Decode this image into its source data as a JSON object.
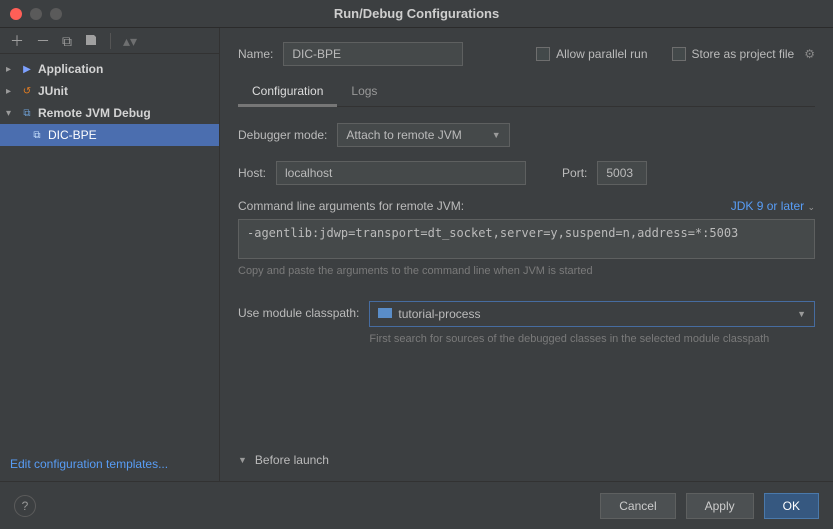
{
  "window": {
    "title": "Run/Debug Configurations"
  },
  "sidebar": {
    "items": [
      {
        "label": "Application"
      },
      {
        "label": "JUnit"
      },
      {
        "label": "Remote JVM Debug"
      },
      {
        "label": "DIC-BPE"
      }
    ],
    "edit_templates": "Edit configuration templates..."
  },
  "form": {
    "name_label": "Name:",
    "name_value": "DIC-BPE",
    "allow_parallel": "Allow parallel run",
    "store_project": "Store as project file"
  },
  "tabs": {
    "configuration": "Configuration",
    "logs": "Logs"
  },
  "config": {
    "debugger_mode_label": "Debugger mode:",
    "debugger_mode_value": "Attach to remote JVM",
    "host_label": "Host:",
    "host_value": "localhost",
    "port_label": "Port:",
    "port_value": "5003",
    "cmd_label": "Command line arguments for remote JVM:",
    "jdk_label": "JDK 9 or later",
    "cmd_value": "-agentlib:jdwp=transport=dt_socket,server=y,suspend=n,address=*:5003",
    "cmd_hint": "Copy and paste the arguments to the command line when JVM is started",
    "classpath_label": "Use module classpath:",
    "classpath_value": "tutorial-process",
    "classpath_hint": "First search for sources of the debugged classes in the selected module classpath",
    "before_launch": "Before launch"
  },
  "footer": {
    "cancel": "Cancel",
    "apply": "Apply",
    "ok": "OK"
  }
}
